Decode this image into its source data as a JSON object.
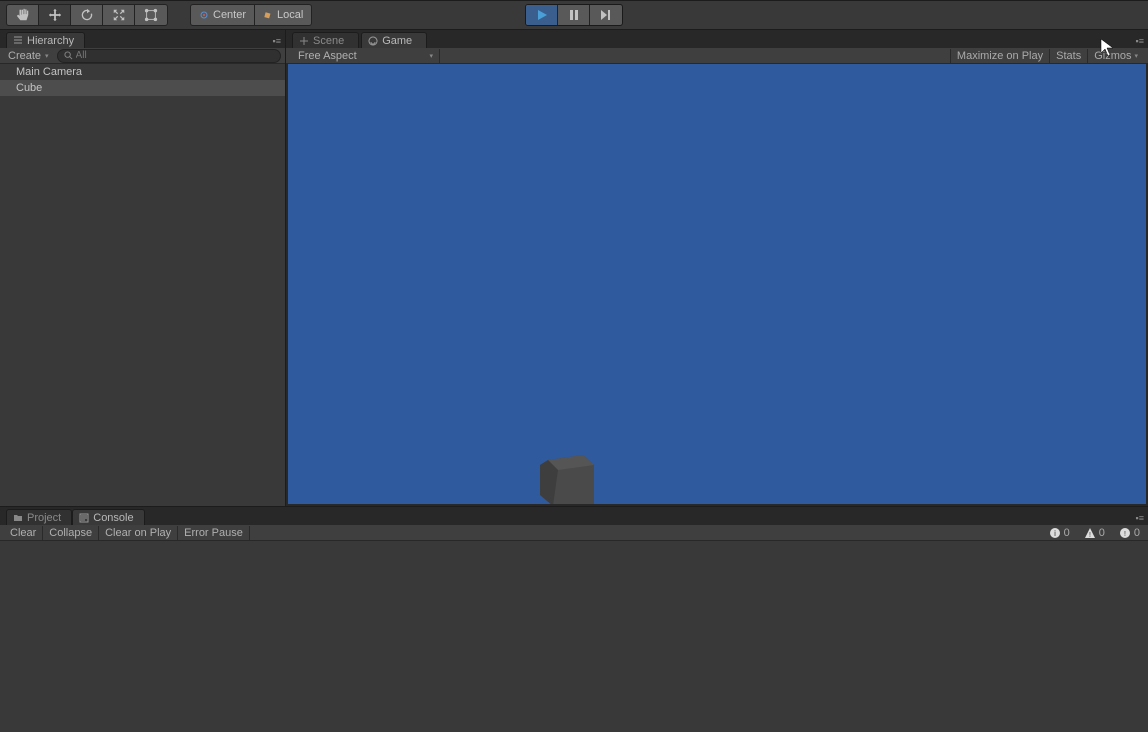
{
  "toolbar": {
    "pivot_center": "Center",
    "pivot_local": "Local"
  },
  "hierarchy": {
    "tab_label": "Hierarchy",
    "create_label": "Create",
    "search_placeholder": "All",
    "items": [
      "Main Camera",
      "Cube"
    ]
  },
  "center": {
    "scene_tab": "Scene",
    "game_tab": "Game",
    "aspect": "Free Aspect",
    "maximize": "Maximize on Play",
    "stats": "Stats",
    "gizmos": "Gizmos"
  },
  "bottom": {
    "project_tab": "Project",
    "console_tab": "Console",
    "clear": "Clear",
    "collapse": "Collapse",
    "clear_on_play": "Clear on Play",
    "error_pause": "Error Pause",
    "info_count": "0",
    "warn_count": "0",
    "error_count": "0"
  }
}
